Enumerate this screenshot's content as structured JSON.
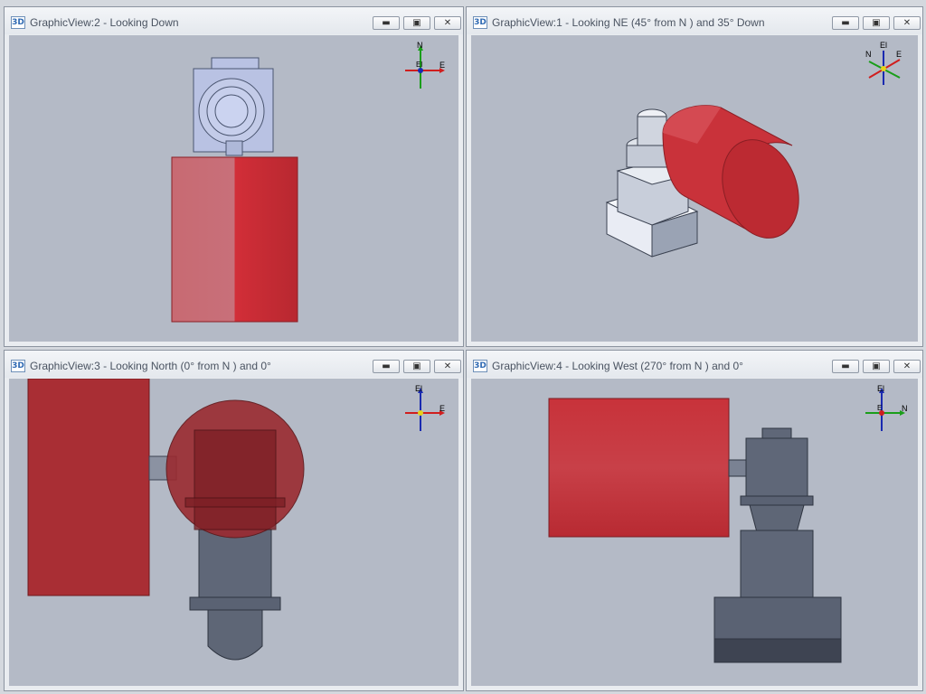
{
  "windows": [
    {
      "id": "view2",
      "title": "GraphicView:2 - Looking Down",
      "icon_label": "3D",
      "axes": {
        "up": "N",
        "right": "E",
        "center": "El"
      }
    },
    {
      "id": "view1",
      "title": "GraphicView:1 - Looking NE (45° from N ) and 35° Down",
      "icon_label": "3D",
      "axes": {
        "up": "El",
        "right": "E",
        "left": "N"
      }
    },
    {
      "id": "view3",
      "title": "GraphicView:3 - Looking North (0° from N ) and 0°",
      "icon_label": "3D",
      "axes": {
        "up": "El",
        "right": "E"
      }
    },
    {
      "id": "view4",
      "title": "GraphicView:4 - Looking West (270° from N ) and 0°",
      "icon_label": "3D",
      "axes": {
        "up": "El",
        "right": "N",
        "center": "E"
      }
    }
  ],
  "window_buttons": {
    "minimize": "▬",
    "maximize": "▣",
    "close": "✕"
  },
  "colors": {
    "viewport_bg": "#b4bac6",
    "actuator_red": "#c8323a",
    "valve_gray": "#5a6273",
    "outline_light": "#aab4d6",
    "axis_up": "#1a9e1a",
    "axis_right": "#d01e1e",
    "axis_down": "#1a2ab0"
  }
}
